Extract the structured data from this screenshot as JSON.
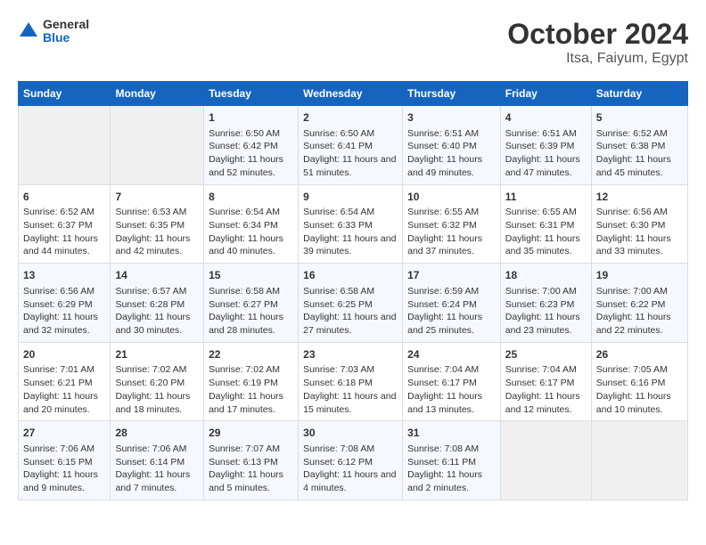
{
  "logo": {
    "general": "General",
    "blue": "Blue"
  },
  "title": "October 2024",
  "subtitle": "Itsa, Faiyum, Egypt",
  "days_header": [
    "Sunday",
    "Monday",
    "Tuesday",
    "Wednesday",
    "Thursday",
    "Friday",
    "Saturday"
  ],
  "weeks": [
    [
      {
        "day": "",
        "info": ""
      },
      {
        "day": "",
        "info": ""
      },
      {
        "day": "1",
        "info": "Sunrise: 6:50 AM\nSunset: 6:42 PM\nDaylight: 11 hours and 52 minutes."
      },
      {
        "day": "2",
        "info": "Sunrise: 6:50 AM\nSunset: 6:41 PM\nDaylight: 11 hours and 51 minutes."
      },
      {
        "day": "3",
        "info": "Sunrise: 6:51 AM\nSunset: 6:40 PM\nDaylight: 11 hours and 49 minutes."
      },
      {
        "day": "4",
        "info": "Sunrise: 6:51 AM\nSunset: 6:39 PM\nDaylight: 11 hours and 47 minutes."
      },
      {
        "day": "5",
        "info": "Sunrise: 6:52 AM\nSunset: 6:38 PM\nDaylight: 11 hours and 45 minutes."
      }
    ],
    [
      {
        "day": "6",
        "info": "Sunrise: 6:52 AM\nSunset: 6:37 PM\nDaylight: 11 hours and 44 minutes."
      },
      {
        "day": "7",
        "info": "Sunrise: 6:53 AM\nSunset: 6:35 PM\nDaylight: 11 hours and 42 minutes."
      },
      {
        "day": "8",
        "info": "Sunrise: 6:54 AM\nSunset: 6:34 PM\nDaylight: 11 hours and 40 minutes."
      },
      {
        "day": "9",
        "info": "Sunrise: 6:54 AM\nSunset: 6:33 PM\nDaylight: 11 hours and 39 minutes."
      },
      {
        "day": "10",
        "info": "Sunrise: 6:55 AM\nSunset: 6:32 PM\nDaylight: 11 hours and 37 minutes."
      },
      {
        "day": "11",
        "info": "Sunrise: 6:55 AM\nSunset: 6:31 PM\nDaylight: 11 hours and 35 minutes."
      },
      {
        "day": "12",
        "info": "Sunrise: 6:56 AM\nSunset: 6:30 PM\nDaylight: 11 hours and 33 minutes."
      }
    ],
    [
      {
        "day": "13",
        "info": "Sunrise: 6:56 AM\nSunset: 6:29 PM\nDaylight: 11 hours and 32 minutes."
      },
      {
        "day": "14",
        "info": "Sunrise: 6:57 AM\nSunset: 6:28 PM\nDaylight: 11 hours and 30 minutes."
      },
      {
        "day": "15",
        "info": "Sunrise: 6:58 AM\nSunset: 6:27 PM\nDaylight: 11 hours and 28 minutes."
      },
      {
        "day": "16",
        "info": "Sunrise: 6:58 AM\nSunset: 6:25 PM\nDaylight: 11 hours and 27 minutes."
      },
      {
        "day": "17",
        "info": "Sunrise: 6:59 AM\nSunset: 6:24 PM\nDaylight: 11 hours and 25 minutes."
      },
      {
        "day": "18",
        "info": "Sunrise: 7:00 AM\nSunset: 6:23 PM\nDaylight: 11 hours and 23 minutes."
      },
      {
        "day": "19",
        "info": "Sunrise: 7:00 AM\nSunset: 6:22 PM\nDaylight: 11 hours and 22 minutes."
      }
    ],
    [
      {
        "day": "20",
        "info": "Sunrise: 7:01 AM\nSunset: 6:21 PM\nDaylight: 11 hours and 20 minutes."
      },
      {
        "day": "21",
        "info": "Sunrise: 7:02 AM\nSunset: 6:20 PM\nDaylight: 11 hours and 18 minutes."
      },
      {
        "day": "22",
        "info": "Sunrise: 7:02 AM\nSunset: 6:19 PM\nDaylight: 11 hours and 17 minutes."
      },
      {
        "day": "23",
        "info": "Sunrise: 7:03 AM\nSunset: 6:18 PM\nDaylight: 11 hours and 15 minutes."
      },
      {
        "day": "24",
        "info": "Sunrise: 7:04 AM\nSunset: 6:17 PM\nDaylight: 11 hours and 13 minutes."
      },
      {
        "day": "25",
        "info": "Sunrise: 7:04 AM\nSunset: 6:17 PM\nDaylight: 11 hours and 12 minutes."
      },
      {
        "day": "26",
        "info": "Sunrise: 7:05 AM\nSunset: 6:16 PM\nDaylight: 11 hours and 10 minutes."
      }
    ],
    [
      {
        "day": "27",
        "info": "Sunrise: 7:06 AM\nSunset: 6:15 PM\nDaylight: 11 hours and 9 minutes."
      },
      {
        "day": "28",
        "info": "Sunrise: 7:06 AM\nSunset: 6:14 PM\nDaylight: 11 hours and 7 minutes."
      },
      {
        "day": "29",
        "info": "Sunrise: 7:07 AM\nSunset: 6:13 PM\nDaylight: 11 hours and 5 minutes."
      },
      {
        "day": "30",
        "info": "Sunrise: 7:08 AM\nSunset: 6:12 PM\nDaylight: 11 hours and 4 minutes."
      },
      {
        "day": "31",
        "info": "Sunrise: 7:08 AM\nSunset: 6:11 PM\nDaylight: 11 hours and 2 minutes."
      },
      {
        "day": "",
        "info": ""
      },
      {
        "day": "",
        "info": ""
      }
    ]
  ]
}
